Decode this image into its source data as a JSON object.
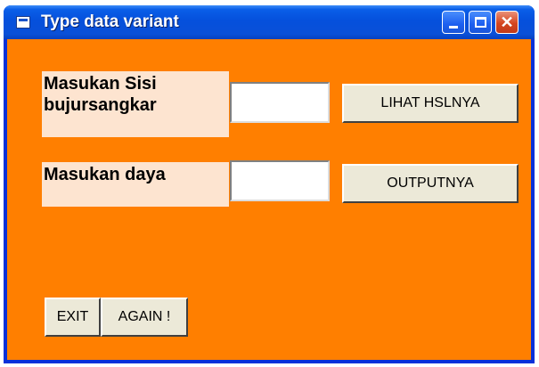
{
  "window": {
    "title": "Type data variant",
    "icon": "form-icon",
    "controls": {
      "minimize": "minimize-icon",
      "maximize": "maximize-icon",
      "close_glyph": "✕"
    }
  },
  "form": {
    "sisi_label": "Masukan Sisi bujursangkar",
    "sisi_value": "",
    "daya_label": "Masukan daya",
    "daya_value": "",
    "lihat_button": "LIHAT HSLNYA",
    "output_button": "OUTPUTNYA",
    "exit_button": "EXIT",
    "again_button": "AGAIN !"
  },
  "colors": {
    "form_background": "#ff7f00",
    "label_background": "#fde4d0",
    "titlebar": "#0550dc",
    "button_face": "#ece9d8"
  }
}
